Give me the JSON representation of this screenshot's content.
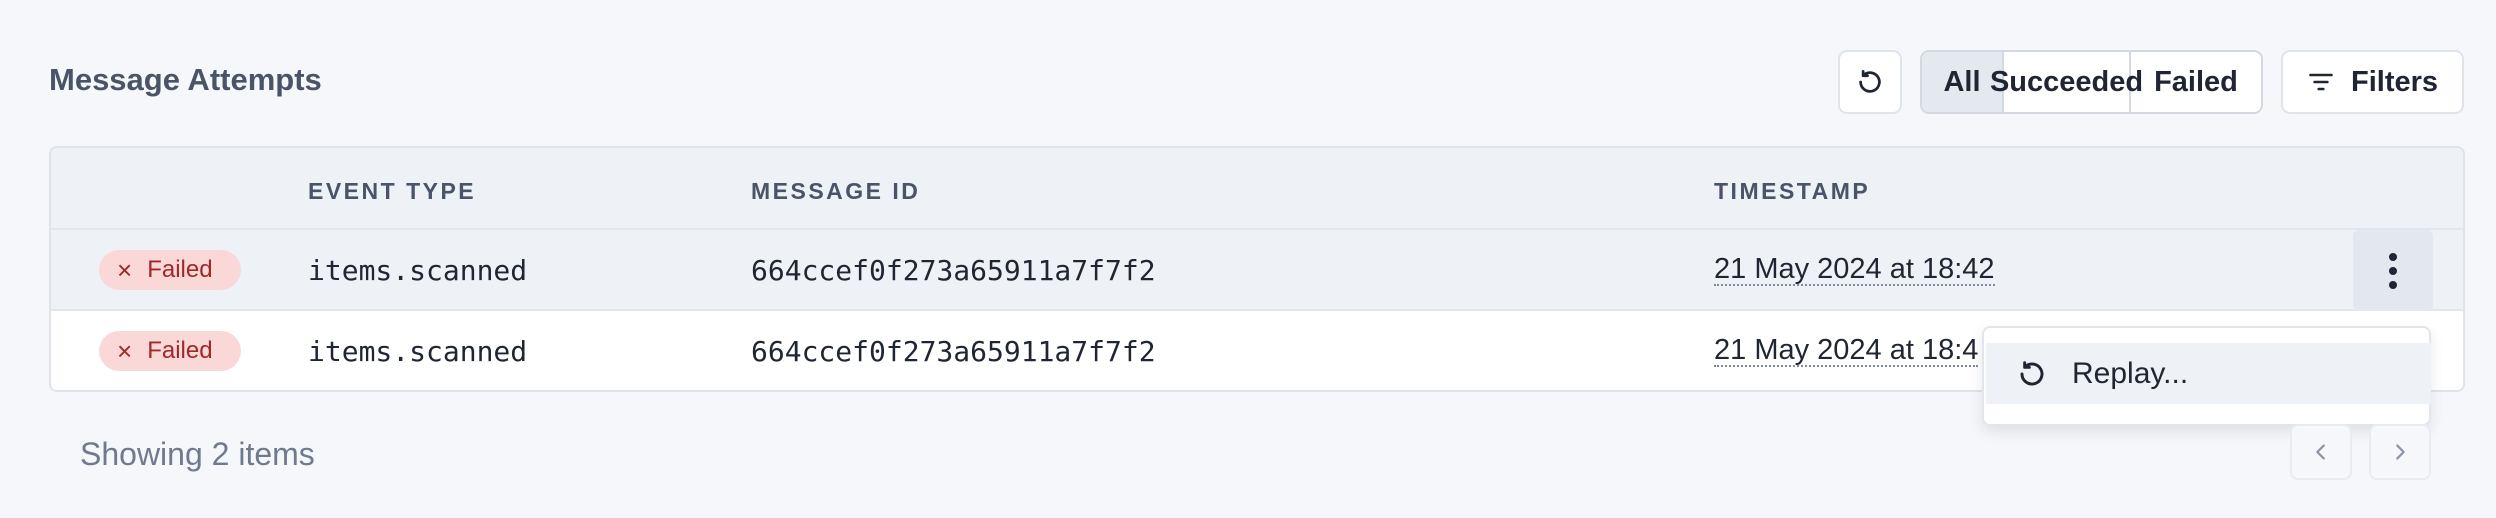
{
  "header": {
    "title": "Message Attempts",
    "refresh_icon": "refresh-icon",
    "status_filter": [
      "All",
      "Succeeded",
      "Failed"
    ],
    "selected_status": "All",
    "filters_label": "Filters",
    "filters_icon": "filter-lines-icon"
  },
  "table": {
    "columns": [
      "",
      "EVENT TYPE",
      "MESSAGE ID",
      "TIMESTAMP"
    ],
    "rows": [
      {
        "status": "Failed",
        "event_type": "items.scanned",
        "message_id": "664ccef0f273a65911a7f7f2",
        "timestamp": "21 May 2024 at 18:42"
      },
      {
        "status": "Failed",
        "event_type": "items.scanned",
        "message_id": "664ccef0f273a65911a7f7f2",
        "timestamp": "21 May 2024 at 18:4"
      }
    ],
    "row_menu_icon": "more-vertical-icon"
  },
  "menu": {
    "items": [
      {
        "label": "Replay...",
        "icon": "replay-icon"
      }
    ]
  },
  "footer": {
    "showing": "Showing 2 items",
    "prev_icon": "chevron-left-icon",
    "next_icon": "chevron-right-icon"
  },
  "colors": {
    "failed_badge_bg": "#fbd8d8",
    "failed_badge_text": "#a12828",
    "header_bg": "#eef1f5",
    "page_bg": "#f6f7fb"
  }
}
